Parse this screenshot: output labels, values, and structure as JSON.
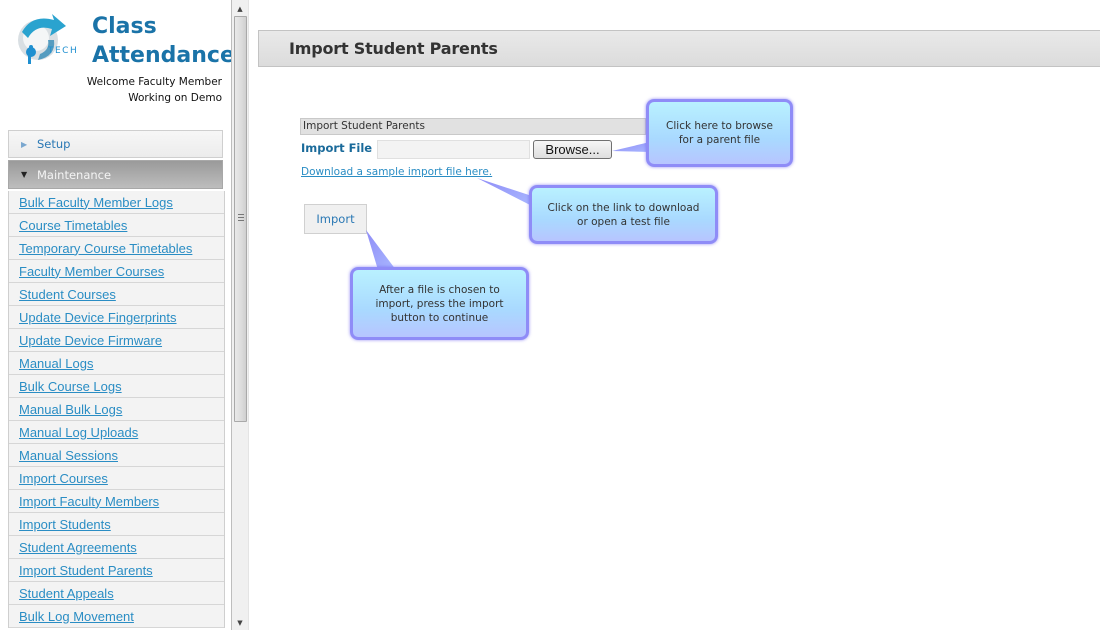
{
  "app": {
    "title_line1": "Class",
    "title_line2": "Attendance",
    "logo_text": "TECH",
    "welcome": "Welcome Faculty Member",
    "working_on": "Working on Demo"
  },
  "sidebar": {
    "sections": [
      {
        "label": "Setup",
        "expanded": false
      },
      {
        "label": "Maintenance",
        "expanded": true
      }
    ],
    "items": [
      {
        "label": "Bulk Faculty Member Logs"
      },
      {
        "label": "Course Timetables"
      },
      {
        "label": "Temporary Course Timetables"
      },
      {
        "label": "Faculty Member Courses"
      },
      {
        "label": "Student Courses"
      },
      {
        "label": "Update Device Fingerprints"
      },
      {
        "label": "Update Device Firmware"
      },
      {
        "label": "Manual Logs"
      },
      {
        "label": "Bulk Course Logs"
      },
      {
        "label": "Manual Bulk Logs"
      },
      {
        "label": "Manual Log Uploads"
      },
      {
        "label": "Manual Sessions"
      },
      {
        "label": "Import Courses"
      },
      {
        "label": "Import Faculty Members"
      },
      {
        "label": "Import Students"
      },
      {
        "label": "Student Agreements"
      },
      {
        "label": "Import Student Parents"
      },
      {
        "label": "Student Appeals"
      },
      {
        "label": "Bulk Log Movement"
      }
    ]
  },
  "page": {
    "title": "Import Student Parents",
    "form": {
      "box_title": "Import Student Parents",
      "import_file_label": "Import File",
      "file_value": "",
      "browse_label": "Browse...",
      "sample_link": "Download a sample import file here.",
      "import_button": "Import"
    }
  },
  "callouts": [
    {
      "text": "Click here to browse for a parent file"
    },
    {
      "text": "Click on the link to download or open a test file"
    },
    {
      "text": "After a file is chosen to import, press the import button to continue"
    }
  ],
  "colors": {
    "brand": "#1a73a8",
    "link": "#2a8dc4",
    "callout_border": "#8f8cf7",
    "callout_fill": "#b9f1ff"
  }
}
